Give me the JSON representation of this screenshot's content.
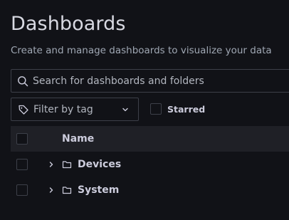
{
  "header": {
    "title": "Dashboards",
    "subtitle": "Create and manage dashboards to visualize your data"
  },
  "search": {
    "placeholder": "Search for dashboards and folders",
    "value": ""
  },
  "filters": {
    "tag_filter_label": "Filter by tag",
    "starred_label": "Starred",
    "starred_checked": false
  },
  "table": {
    "columns": [
      "Name"
    ],
    "rows": [
      {
        "name": "Devices",
        "type": "folder",
        "expanded": false,
        "checked": false
      },
      {
        "name": "System",
        "type": "folder",
        "expanded": false,
        "checked": false
      }
    ]
  },
  "icons": {
    "search": "search-icon",
    "tag": "tag-icon",
    "chevron": "chevron-down-icon",
    "expander": "chevron-right-icon",
    "folder": "folder-icon"
  },
  "colors": {
    "background": "#111217",
    "header_row": "#1f2026",
    "border": "#3d4049",
    "text": "#ccccdc",
    "muted_text": "#9fa7b3"
  }
}
